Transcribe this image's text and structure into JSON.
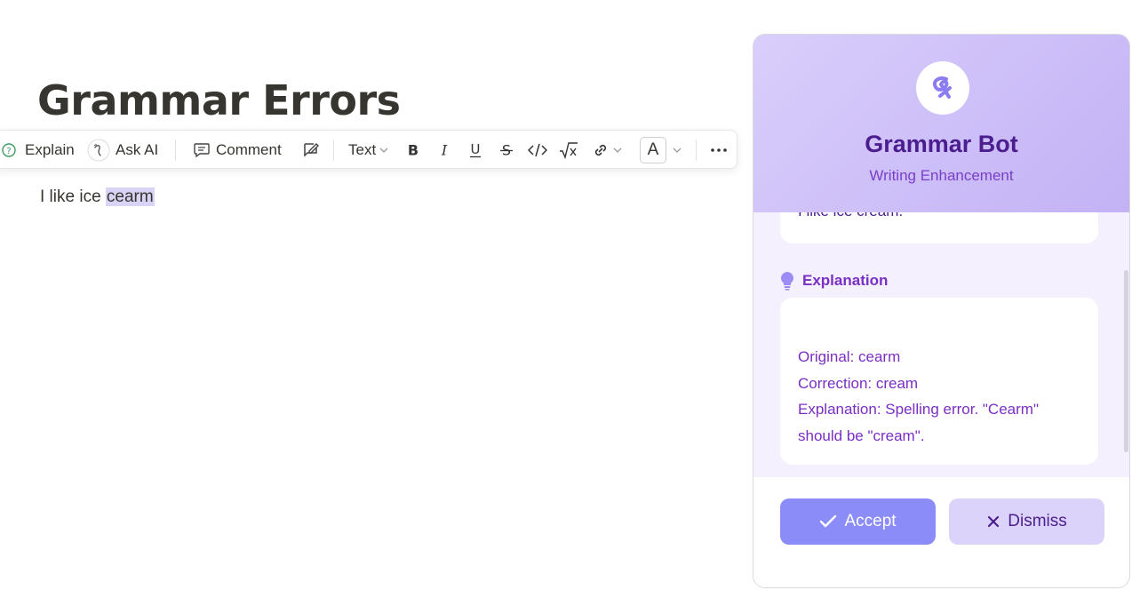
{
  "document": {
    "title": "Grammar Errors",
    "line_prefix": "I like ice ",
    "line_highlight": "cearm"
  },
  "toolbar": {
    "explain": "Explain",
    "ask_ai": "Ask AI",
    "comment": "Comment",
    "text_style": "Text",
    "font_color_letter": "A"
  },
  "panel": {
    "title": "Grammar Bot",
    "subtitle": "Writing Enhancement",
    "corrected_text": "I like ice cream.",
    "explanation_heading": "Explanation",
    "explanation_lines": [
      "Original: cearm",
      "Correction: cream",
      "Explanation: Spelling error. \"Cearm\"",
      "should be \"cream\"."
    ],
    "accept_label": "Accept",
    "dismiss_label": "Dismiss"
  },
  "colors": {
    "accent": "#8b8cf7",
    "brand_purple": "#4b1d8f",
    "explanation_text": "#7a2fc4",
    "highlight": "#d9d3f5"
  }
}
